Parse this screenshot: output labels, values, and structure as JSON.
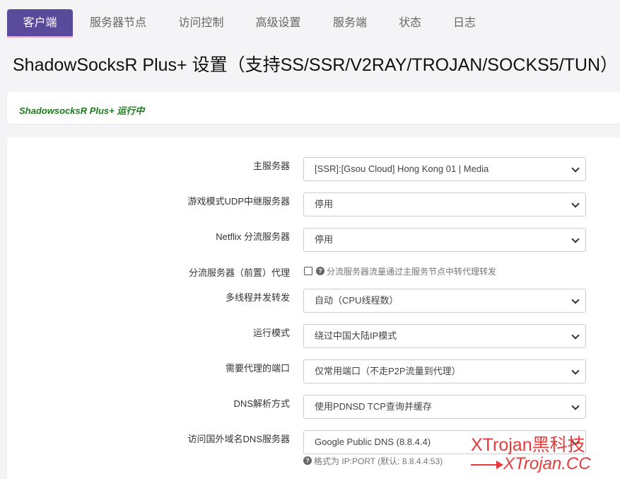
{
  "tabs": [
    "客户端",
    "服务器节点",
    "访问控制",
    "高级设置",
    "服务端",
    "状态",
    "日志"
  ],
  "page_title": "ShadowSocksR Plus+ 设置（支持SS/SSR/V2RAY/TROJAN/SOCKS5/TUN）",
  "status": "ShadowsocksR Plus+ 运行中",
  "form": {
    "main_server": {
      "label": "主服务器",
      "value": "[SSR]:[Gsou Cloud] Hong Kong 01 | Media"
    },
    "udp_relay": {
      "label": "游戏模式UDP中继服务器",
      "value": "停用"
    },
    "netflix": {
      "label": "Netflix 分流服务器",
      "value": "停用"
    },
    "pre_proxy": {
      "label": "分流服务器（前置）代理",
      "help": "分流服务器流量通过主服务节点中转代理转发"
    },
    "threads": {
      "label": "多线程并发转发",
      "value": "自动（CPU线程数）"
    },
    "run_mode": {
      "label": "运行模式",
      "value": "绕过中国大陆IP模式"
    },
    "ports": {
      "label": "需要代理的端口",
      "value": "仅常用端口（不走P2P流量到代理）"
    },
    "dns_mode": {
      "label": "DNS解析方式",
      "value": "使用PDNSD TCP查询并缓存"
    },
    "dns_server": {
      "label": "访问国外域名DNS服务器",
      "value": "Google Public DNS (8.8.4.4)",
      "help": "格式为 IP:PORT (默认: 8.8.4.4:53)"
    }
  },
  "watermark": {
    "line1": "XTrojan黑科技",
    "line2": "XTrojan.CC"
  },
  "colors": {
    "accent": "#5a4a9c",
    "status_green": "#1e7a1e",
    "watermark": "#e83a3a"
  }
}
